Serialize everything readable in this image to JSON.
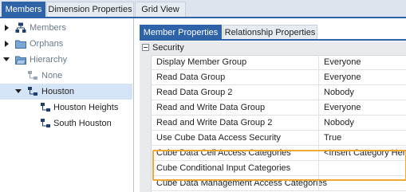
{
  "top_tabs": [
    {
      "label": "Members",
      "active": true
    },
    {
      "label": "Dimension Properties",
      "active": false
    },
    {
      "label": "Grid View",
      "active": false
    }
  ],
  "tree": {
    "nodes": [
      {
        "label": "Members",
        "icon": "hierarchy-icon"
      },
      {
        "label": "Orphans",
        "icon": "folder-icon"
      },
      {
        "label": "Hierarchy",
        "icon": "folder-open-icon"
      },
      {
        "label": "None",
        "icon": "member-icon"
      },
      {
        "label": "Houston",
        "icon": "hierarchy-icon"
      },
      {
        "label": "Houston Heights",
        "icon": "hierarchy-icon"
      },
      {
        "label": "South Houston",
        "icon": "hierarchy-icon"
      }
    ]
  },
  "sub_tabs": [
    {
      "label": "Member Properties",
      "active": true
    },
    {
      "label": "Relationship Properties",
      "active": false
    }
  ],
  "grid": {
    "section": "Security",
    "rows": [
      {
        "name": "Display Member Group",
        "value": "Everyone"
      },
      {
        "name": "Read Data Group",
        "value": "Everyone"
      },
      {
        "name": "Read Data Group 2",
        "value": "Nobody"
      },
      {
        "name": "Read and Write Data Group",
        "value": "Everyone"
      },
      {
        "name": "Read and Write Data Group 2",
        "value": "Nobody"
      },
      {
        "name": "Use Cube Data Access Security",
        "value": "True"
      },
      {
        "name": "Cube Data Cell Access Categories",
        "value": "<Insert Category Here>"
      },
      {
        "name": "Cube Conditional Input Categories",
        "value": ""
      },
      {
        "name": "Cube Data Management Access Categories",
        "value": ""
      }
    ]
  },
  "colors": {
    "accent": "#2f63a7",
    "highlight": "#f0a830",
    "selection": "#d4e3f5"
  }
}
